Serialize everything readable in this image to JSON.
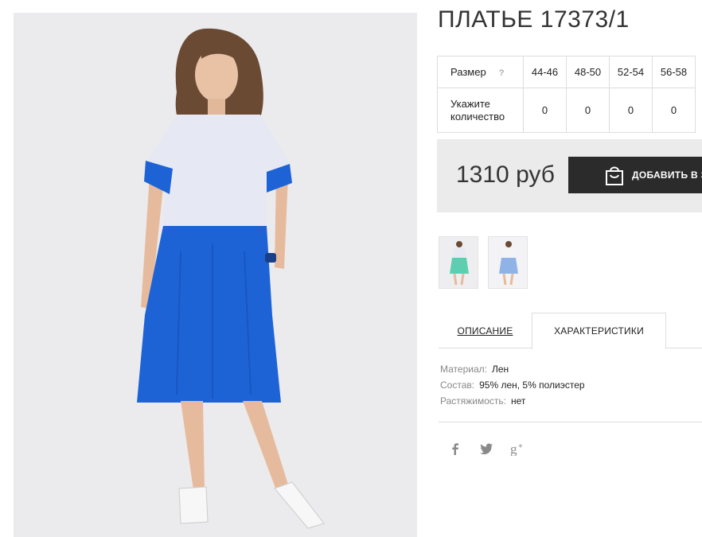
{
  "product": {
    "title": "ПЛАТЬЕ 17373/1",
    "price": "1310 руб",
    "add_to_cart_label": "ДОБАВИТЬ В З"
  },
  "size_table": {
    "size_label": "Размер",
    "help_mark": "?",
    "sizes": [
      "44-46",
      "48-50",
      "52-54",
      "56-58"
    ],
    "quantity_label": "Укажите количество",
    "quantities": [
      "0",
      "0",
      "0",
      "0"
    ]
  },
  "thumbnails": [
    {
      "name": "thumbnail-mint-dress"
    },
    {
      "name": "thumbnail-lightblue-dress"
    }
  ],
  "tabs": {
    "description": "ОПИСАНИЕ",
    "characteristics": "ХАРАКТЕРИСТИКИ"
  },
  "characteristics": [
    {
      "key": "Материал:",
      "value": "Лен"
    },
    {
      "key": "Состав:",
      "value": "95% лен, 5% полиэстер"
    },
    {
      "key": "Растяжимость:",
      "value": "нет"
    }
  ],
  "social": [
    "facebook-icon",
    "twitter-icon",
    "google-plus-icon"
  ],
  "colors": {
    "dress_top": "#e6e8f3",
    "dress_skirt": "#1e63d6",
    "button_bg": "#2b2b2b",
    "price_bg": "#ebebeb"
  }
}
